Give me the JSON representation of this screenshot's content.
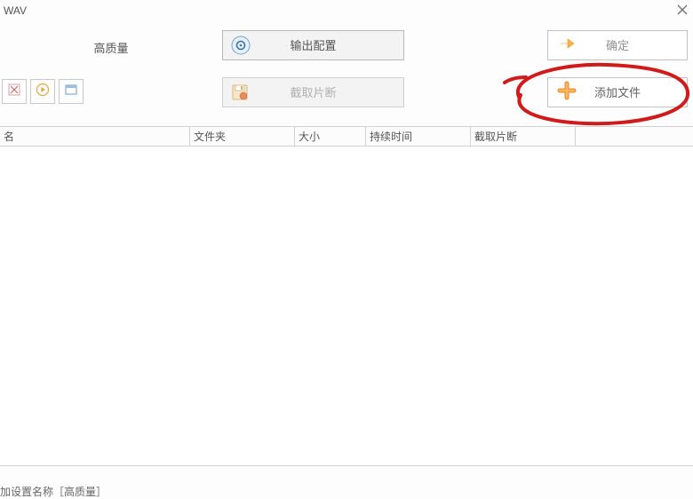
{
  "titlebar": {
    "title": "WAV"
  },
  "toolbar_top": {
    "quality_label": "高质量",
    "output_config_label": "输出配置",
    "confirm_label": "确定"
  },
  "toolbar_second": {
    "clip_label": "截取片断",
    "add_file_label": "添加文件"
  },
  "columns": {
    "c0": "名",
    "c1": "文件夹",
    "c2": "大小",
    "c3": "持续时间",
    "c4": "截取片断",
    "c5": ""
  },
  "statusbar": {
    "text": "加设置名称［高质量］"
  },
  "icons": {
    "close": "close-icon",
    "gear": "gear-icon",
    "arrow_right": "arrow-right-icon",
    "save": "save-icon",
    "plus": "plus-icon",
    "remove": "remove-icon",
    "play": "play-icon",
    "window": "window-icon"
  }
}
